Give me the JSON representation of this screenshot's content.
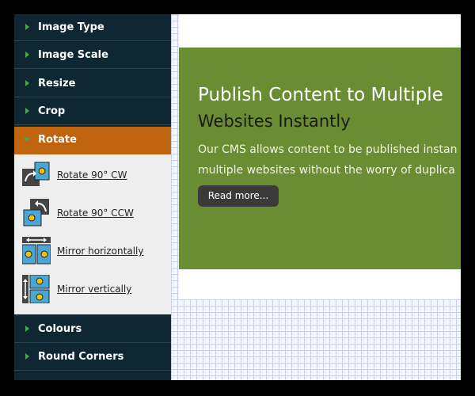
{
  "sidebar": {
    "items": [
      {
        "label": "Image Type"
      },
      {
        "label": "Image Scale"
      },
      {
        "label": "Resize"
      },
      {
        "label": "Crop"
      },
      {
        "label": "Rotate"
      },
      {
        "label": "Colours"
      },
      {
        "label": "Round Corners"
      }
    ],
    "submenu": [
      {
        "label": "Rotate 90° CW",
        "icon": "rotate-cw-icon"
      },
      {
        "label": "Rotate 90° CCW",
        "icon": "rotate-ccw-icon"
      },
      {
        "label": "Mirror horizontally",
        "icon": "mirror-horizontal-icon"
      },
      {
        "label": "Mirror vertically",
        "icon": "mirror-vertical-icon"
      }
    ]
  },
  "banner": {
    "title_line1": "Publish Content to Multiple",
    "title_line2": "Websites Instantly",
    "text_line1": "Our CMS allows content to be published instan",
    "text_line2": "multiple websites without the worry of duplica",
    "button_label": "Read more..."
  },
  "colors": {
    "sidebar_bg": "#0f2733",
    "active_item": "#c0640f",
    "arrow": "#4aa84a",
    "banner_green": "#6a8c33"
  }
}
